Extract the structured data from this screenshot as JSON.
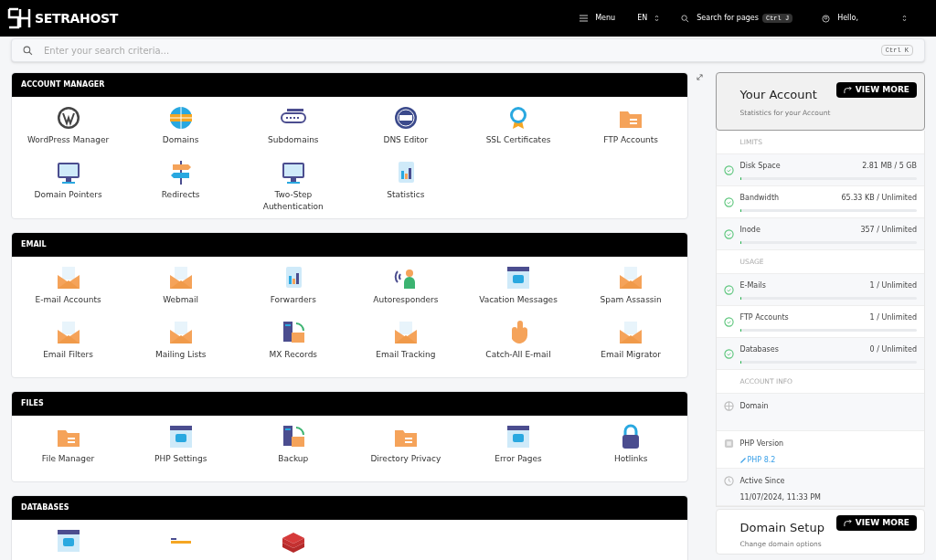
{
  "header": {
    "brand": "SETRAHOST",
    "menu": "Menu",
    "language": "EN",
    "page_search": "Search for pages",
    "page_search_shortcut": "Ctrl J",
    "greeting": "Hello,"
  },
  "search": {
    "placeholder": "Enter your search criteria...",
    "shortcut": "Ctrl K"
  },
  "sections": [
    {
      "title": "ACCOUNT MANAGER",
      "items": [
        {
          "label": "WordPress Manager",
          "kind": "wordpress"
        },
        {
          "label": "Domains",
          "kind": "globe"
        },
        {
          "label": "Subdomains",
          "kind": "bar"
        },
        {
          "label": "DNS Editor",
          "kind": "dns"
        },
        {
          "label": "SSL Certificates",
          "kind": "ribbon"
        },
        {
          "label": "FTP Accounts",
          "kind": "folder"
        },
        {
          "label": "Domain Pointers",
          "kind": "monitor"
        },
        {
          "label": "Redirects",
          "kind": "signpost"
        },
        {
          "label": "Two-Step Authentication",
          "kind": "monitor"
        },
        {
          "label": "Statistics",
          "kind": "doc"
        }
      ]
    },
    {
      "title": "EMAIL",
      "items": [
        {
          "label": "E-mail Accounts",
          "kind": "mail"
        },
        {
          "label": "Webmail",
          "kind": "mail"
        },
        {
          "label": "Forwarders",
          "kind": "doc"
        },
        {
          "label": "Autoresponders",
          "kind": "person"
        },
        {
          "label": "Vacation Messages",
          "kind": "window"
        },
        {
          "label": "Spam Assassin",
          "kind": "mail"
        },
        {
          "label": "Email Filters",
          "kind": "mail"
        },
        {
          "label": "Mailing Lists",
          "kind": "mail"
        },
        {
          "label": "MX Records",
          "kind": "server"
        },
        {
          "label": "Email Tracking",
          "kind": "mail"
        },
        {
          "label": "Catch-All E-mail",
          "kind": "hand"
        },
        {
          "label": "Email Migrator",
          "kind": "mail"
        }
      ]
    },
    {
      "title": "FILES",
      "items": [
        {
          "label": "File Manager",
          "kind": "folder"
        },
        {
          "label": "PHP Settings",
          "kind": "window"
        },
        {
          "label": "Backup",
          "kind": "server"
        },
        {
          "label": "Directory Privacy",
          "kind": "folder"
        },
        {
          "label": "Error Pages",
          "kind": "window"
        },
        {
          "label": "Hotlinks",
          "kind": "lock"
        }
      ]
    },
    {
      "title": "DATABASES",
      "items": [
        {
          "kind": "window"
        },
        {
          "kind": "wordmark"
        },
        {
          "kind": "stack"
        }
      ]
    }
  ],
  "account": {
    "title": "Your Account",
    "subtitle": "Statistics for your Account",
    "button": "VIEW MORE",
    "rows": [
      {
        "kind": "heading",
        "label": "LIMITS"
      },
      {
        "kind": "meter",
        "label": "Disk Space",
        "reading": "2.81 MB / 5 GB",
        "level": 0.01
      },
      {
        "kind": "meter",
        "label": "Bandwidth",
        "reading": "65.33 KB / Unlimited",
        "level": 0.01
      },
      {
        "kind": "meter",
        "label": "Inode",
        "reading": "357 / Unlimited",
        "level": 0.01
      },
      {
        "kind": "heading",
        "label": "USAGE"
      },
      {
        "kind": "meter",
        "label": "E-Mails",
        "reading": "1 / Unlimited",
        "level": 0.01
      },
      {
        "kind": "meter",
        "label": "FTP Accounts",
        "reading": "1 / Unlimited",
        "level": 0.01
      },
      {
        "kind": "meter",
        "label": "Databases",
        "reading": "0 / Unlimited",
        "level": 0.01
      },
      {
        "kind": "heading",
        "label": "ACCOUNT INFO"
      },
      {
        "kind": "info",
        "label": "Domain"
      },
      {
        "kind": "info",
        "label": "PHP Version",
        "link": "PHP 8.2"
      },
      {
        "kind": "info",
        "label": "Active Since",
        "value": "11/07/2024, 11:33 PM"
      }
    ]
  },
  "domain_setup": {
    "title": "Domain Setup",
    "subtitle": "Change domain options",
    "button": "VIEW MORE"
  }
}
